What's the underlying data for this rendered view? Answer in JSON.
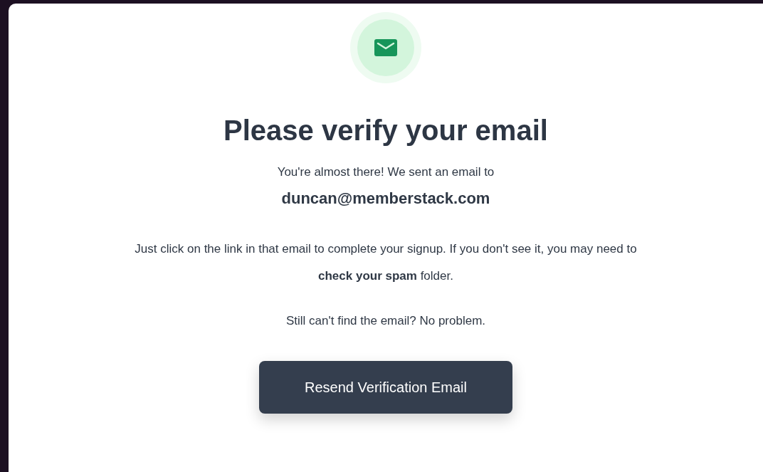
{
  "title": "Please verify your email",
  "intro": "You're almost there! We sent an email to",
  "email": "duncan@memberstack.com",
  "instructions": "Just click on the link in that email to complete your signup. If you don't see it, you may need to **check your spam** folder.",
  "help": "Still can't find the email? No problem.",
  "button": "Resend Verification Email"
}
